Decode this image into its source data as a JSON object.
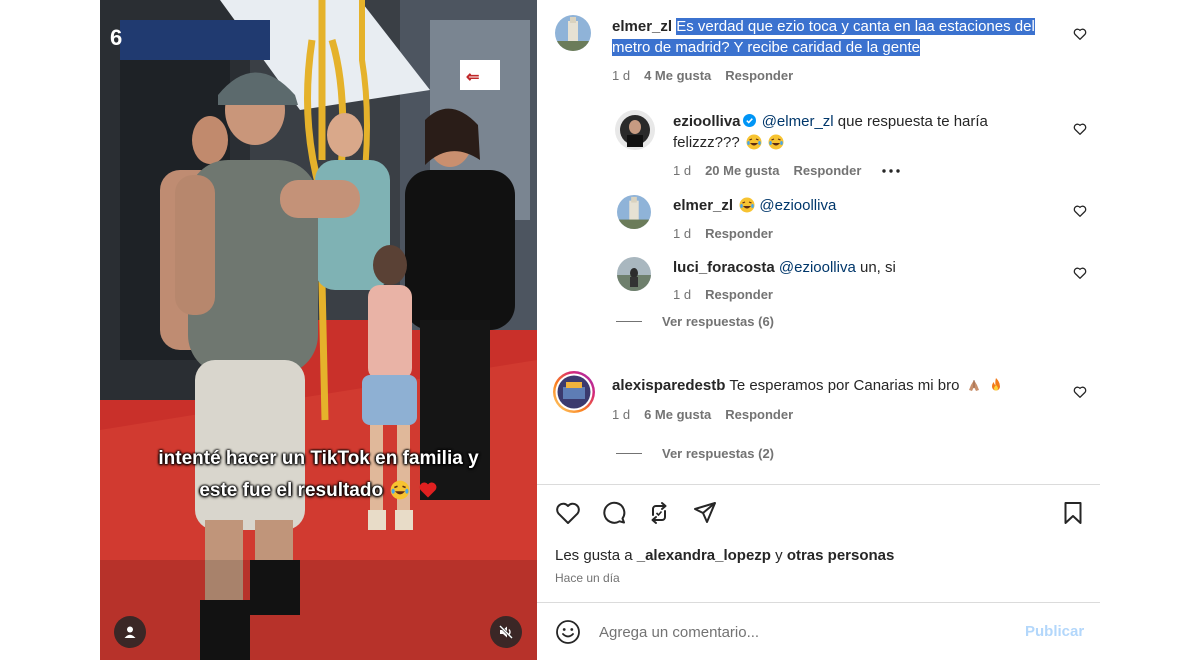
{
  "video": {
    "caption_line1": "intenté hacer un TikTok en familia y",
    "caption_line2": "este fue el resultado",
    "caption_emojis": [
      "laughing-tears-emoji",
      "red-heart-emoji"
    ],
    "controls": {
      "user_icon": "user-icon",
      "mute_icon": "muted-speaker-icon"
    }
  },
  "comments": [
    {
      "username": "elmer_zl",
      "text": "Es verdad que ezio toca y canta en laa estaciones del metro de madrid? Y recibe caridad de la gente",
      "text_line1": "Es verdad que ezio toca y canta en laa estaciones del",
      "text_line2": "metro de madrid? Y recibe caridad de la gente",
      "time": "1 d",
      "likes": "4 Me gusta",
      "reply_label": "Responder",
      "avatar": "building-photo-avatar",
      "replies": [
        {
          "username": "ezioolliva",
          "username_display": "ezioolliva",
          "verified": true,
          "mention": "@elmer_zl",
          "text_line1": "que respuesta te haría",
          "text_line2": "felizzz???",
          "emojis": [
            "laughing-tears-emoji",
            "laughing-tears-emoji"
          ],
          "time": "1 d",
          "likes": "20 Me gusta",
          "reply_label": "Responder",
          "more_icon": "more-options-icon",
          "avatar": "man-photo-avatar"
        },
        {
          "username": "elmer_zl",
          "emojis": [
            "laughing-tears-emoji"
          ],
          "mention": "@ezioolliva",
          "time": "1 d",
          "reply_label": "Responder",
          "avatar": "building-photo-avatar"
        },
        {
          "username": "luci_foracosta",
          "mention": "@ezioolliva",
          "text": "un, si",
          "time": "1 d",
          "reply_label": "Responder",
          "avatar": "beach-photo-avatar"
        }
      ],
      "view_replies": "Ver respuestas (6)"
    },
    {
      "username": "alexisparedestb",
      "text": "Te esperamos por Canarias mi bro",
      "emojis": [
        "praying-hands-emoji",
        "fire-emoji"
      ],
      "time": "1 d",
      "likes": "6 Me gusta",
      "reply_label": "Responder",
      "avatar": "story-ring-avatar",
      "view_replies": "Ver respuestas (2)"
    }
  ],
  "actions": {
    "icons": [
      "heart-icon",
      "comment-icon",
      "repost-icon",
      "share-icon",
      "bookmark-icon"
    ]
  },
  "likes_line": {
    "prefix": "Les gusta a",
    "user": "_alexandra_lopezp",
    "middle": "y",
    "suffix": "otras personas"
  },
  "timestamp": "Hace un día",
  "add_comment": {
    "placeholder": "Agrega un comentario...",
    "publish_label": "Publicar"
  },
  "colors": {
    "accent": "#0095f6",
    "publish_disabled": "#b3d7fb",
    "highlight": "#3b72cf",
    "mention": "#00376b",
    "muted": "#737373"
  }
}
